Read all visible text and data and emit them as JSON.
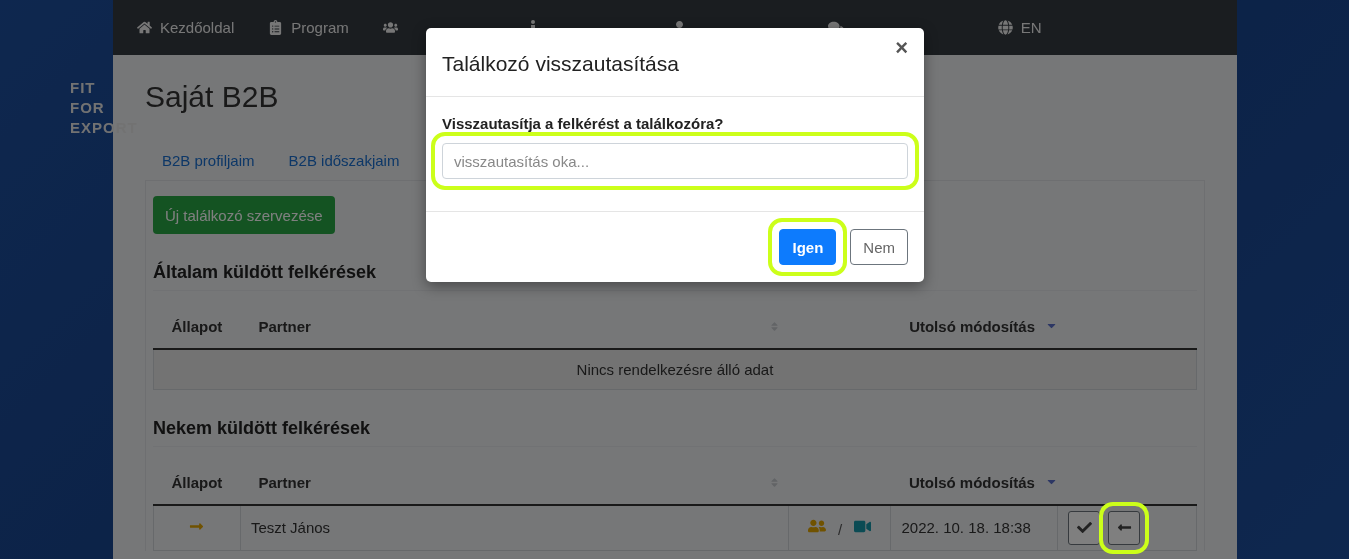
{
  "logo": {
    "lines": [
      "FIT",
      "FOR",
      "EXPORT"
    ]
  },
  "nav": [
    {
      "kind": "link",
      "label": "Kezdőoldal"
    },
    {
      "kind": "link",
      "label": "Program"
    },
    {
      "kind": "covered"
    },
    {
      "kind": "covered"
    },
    {
      "kind": "covered"
    },
    {
      "kind": "covered"
    },
    {
      "kind": "link",
      "label": "EN"
    }
  ],
  "page_title": "Saját B2B",
  "tabs": [
    {
      "label": "B2B profiljaim"
    },
    {
      "label": "B2B időszakjaim"
    }
  ],
  "new_button": "Új találkozó szervezése",
  "sections": [
    {
      "title": "Általam küldött felkérések",
      "columns": [
        {
          "label": "Állapot",
          "kind": "plain"
        },
        {
          "label": "Partner",
          "kind": "sortable"
        },
        {
          "label": "Utolsó módosítás",
          "kind": "sorted_desc"
        }
      ],
      "empty_text": "Nincs rendelkezésre álló adat"
    },
    {
      "title": "Nekem küldött felkérések",
      "columns": [
        {
          "label": "Állapot",
          "kind": "plain"
        },
        {
          "label": "Partner",
          "kind": "sortable"
        },
        {
          "label": "Utolsó módosítás",
          "kind": "sorted_desc"
        }
      ],
      "rows": [
        {
          "kind": "incoming",
          "partner": "Teszt János",
          "meeting_types": [
            {
              "kind": "in_person"
            },
            {
              "kind": "online"
            }
          ],
          "separator": "/",
          "modified": "2022. 10. 18. 18:38",
          "actions": [
            {
              "kind": "accept",
              "highlighted": false
            },
            {
              "kind": "back",
              "highlighted": true
            }
          ]
        }
      ]
    }
  ],
  "modal": {
    "title": "Találkozó visszautasítása",
    "close": "×",
    "question": "Visszautasítja a felkérést a találkozóra?",
    "input": {
      "placeholder": "visszautasítás oka...",
      "highlighted": true
    },
    "buttons": [
      {
        "label": "Igen",
        "kind": "primary",
        "highlighted": true
      },
      {
        "label": "Nem",
        "kind": "secondary",
        "highlighted": false
      }
    ]
  }
}
